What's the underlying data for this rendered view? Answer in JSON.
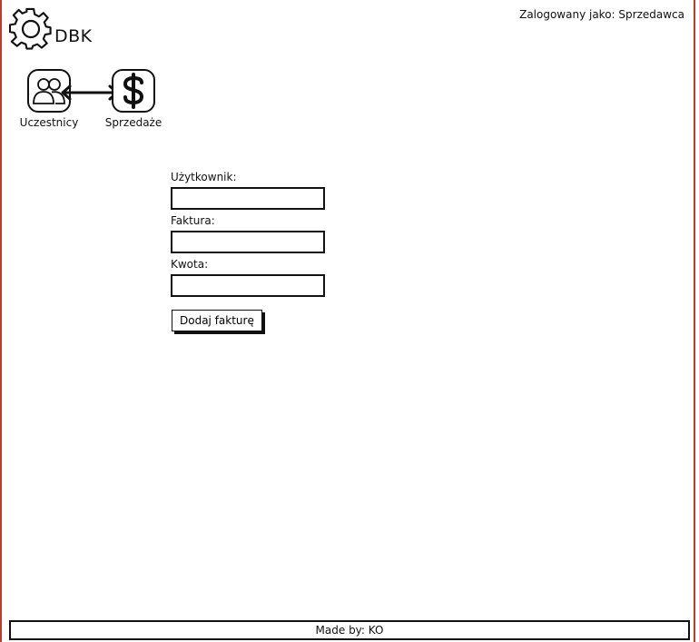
{
  "header": {
    "app_title": "DBK",
    "logo_icon": "gear-icon",
    "user_status": "Zalogowany jako: Sprzedawca"
  },
  "nav": {
    "items": [
      {
        "label": "Uczestnicy",
        "icon": "users-icon"
      },
      {
        "label": "Sprzedaże",
        "icon": "dollar-icon"
      }
    ],
    "connector_icon": "double-arrow-icon"
  },
  "form": {
    "user_label": "Użytkownik:",
    "user_value": "",
    "invoice_label": "Faktura:",
    "invoice_value": "",
    "amount_label": "Kwota:",
    "amount_value": "",
    "submit_label": "Dodaj fakturę"
  },
  "footer": {
    "text": "Made by: KO"
  },
  "colors": {
    "frame_accent": "#c0392b",
    "ink": "#111111",
    "background": "#ffffff"
  }
}
